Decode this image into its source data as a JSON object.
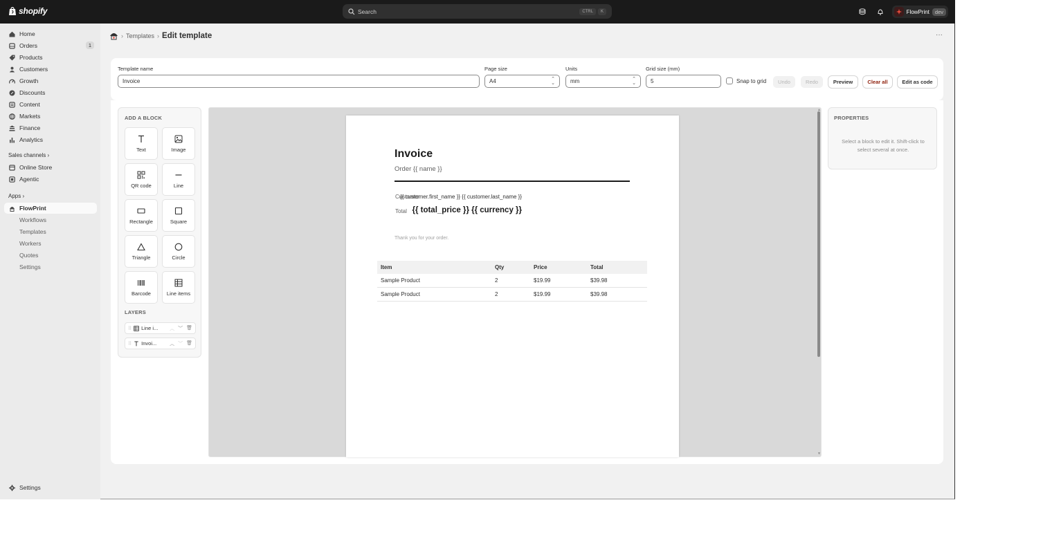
{
  "topbar": {
    "brand": "shopify",
    "search_placeholder": "Search",
    "shortcut_ctrl": "CTRL",
    "shortcut_key": "K",
    "store_name": "FlowPrint",
    "store_env": "dev"
  },
  "sidebar": {
    "items": [
      {
        "label": "Home",
        "icon": "home-icon"
      },
      {
        "label": "Orders",
        "icon": "orders-icon",
        "badge": "1"
      },
      {
        "label": "Products",
        "icon": "tag-icon"
      },
      {
        "label": "Customers",
        "icon": "person-icon"
      },
      {
        "label": "Growth",
        "icon": "gauge-icon"
      },
      {
        "label": "Discounts",
        "icon": "discount-icon"
      },
      {
        "label": "Content",
        "icon": "content-icon"
      },
      {
        "label": "Markets",
        "icon": "globe-icon"
      },
      {
        "label": "Finance",
        "icon": "bank-icon"
      },
      {
        "label": "Analytics",
        "icon": "bar-chart-icon"
      }
    ],
    "sales_channels_label": "Sales channels",
    "channels": [
      {
        "label": "Online Store",
        "icon": "store-icon"
      },
      {
        "label": "Agentic",
        "icon": "agentic-icon"
      }
    ],
    "apps_label": "Apps",
    "app": {
      "label": "FlowPrint",
      "icon": "flowprint-icon"
    },
    "app_subitems": [
      "Workflows",
      "Templates",
      "Workers",
      "Quotes",
      "Settings"
    ],
    "settings_label": "Settings"
  },
  "breadcrumb": {
    "parent": "Templates",
    "current": "Edit template",
    "more": "···"
  },
  "form": {
    "template_name_label": "Template name",
    "template_name_value": "Invoice",
    "page_size_label": "Page size",
    "page_size_value": "A4",
    "units_label": "Units",
    "units_value": "mm",
    "grid_size_label": "Grid size (mm)",
    "grid_size_value": "5",
    "snap_label": "Snap to grid",
    "snap_checked": false,
    "undo": "Undo",
    "redo": "Redo",
    "preview": "Preview",
    "clear_all": "Clear all",
    "edit_as_code": "Edit as code"
  },
  "palette": {
    "title": "ADD A BLOCK",
    "blocks": [
      {
        "label": "Text",
        "icon": "text-icon"
      },
      {
        "label": "Image",
        "icon": "image-icon"
      },
      {
        "label": "QR code",
        "icon": "qr-code-icon"
      },
      {
        "label": "Line",
        "icon": "line-icon"
      },
      {
        "label": "Rectangle",
        "icon": "rectangle-icon"
      },
      {
        "label": "Square",
        "icon": "square-icon"
      },
      {
        "label": "Triangle",
        "icon": "triangle-icon"
      },
      {
        "label": "Circle",
        "icon": "circle-icon"
      },
      {
        "label": "Barcode",
        "icon": "barcode-icon"
      },
      {
        "label": "Line items",
        "icon": "table-icon"
      }
    ],
    "layers_title": "LAYERS",
    "layers": [
      {
        "label": "Line i...",
        "icon": "table-icon"
      },
      {
        "label": "Invoi...",
        "icon": "text-icon"
      }
    ]
  },
  "document": {
    "title": "Invoice",
    "subtitle": "Order {{ name }}",
    "customer_label": "Customer",
    "customer_value": "{{ customer.first_name }} {{ customer.last_name }}",
    "total_label": "Total",
    "total_value": "{{ total_price }} {{ currency }}",
    "thanks": "Thank you for your order.",
    "table": {
      "headers": [
        "Item",
        "Qty",
        "Price",
        "Total"
      ],
      "rows": [
        [
          "Sample Product",
          "2",
          "$19.99",
          "$39.98"
        ],
        [
          "Sample Product",
          "2",
          "$19.99",
          "$39.98"
        ]
      ]
    }
  },
  "properties": {
    "title": "PROPERTIES",
    "hint": "Select a block to edit it. Shift-click to select several at once."
  }
}
